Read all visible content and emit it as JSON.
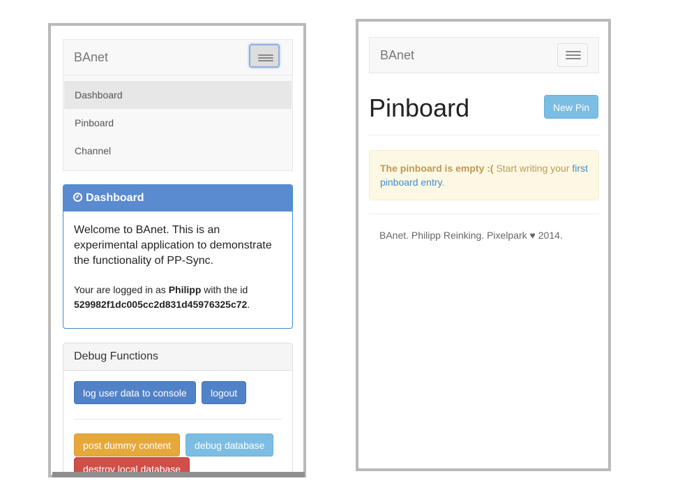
{
  "left": {
    "brand": "BAnet",
    "menu": [
      "Dashboard",
      "Pinboard",
      "Channel"
    ],
    "dashboard_panel": {
      "title": "Dashboard",
      "welcome": "Welcome to BAnet. This is an experimental application to demonstrate the functionality of PP-Sync.",
      "logged_prefix": "Your are logged in as ",
      "user": "Philipp",
      "id_prefix": " with the id ",
      "user_id": "529982f1dc005cc2d831d45976325c72",
      "period": "."
    },
    "debug_panel": {
      "title": "Debug Functions",
      "buttons": [
        "log user data to console",
        "logout",
        "post dummy content",
        "debug database",
        "destroy local database"
      ]
    }
  },
  "right": {
    "brand": "BAnet",
    "page_title": "Pinboard",
    "new_pin_label": "New Pin",
    "alert_bold": "The pinboard is empty :(",
    "alert_text": " Start writing your ",
    "alert_link": "first pinboard entry",
    "alert_end": ".",
    "footer": "BAnet. Philipp Reinking. Pixelpark ♥ 2014."
  },
  "colors": {
    "primary": "#5182c8",
    "warning": "#e7a83b",
    "info": "#7cbde3",
    "danger": "#cf4f49",
    "alert_bg": "#fcf8e3"
  }
}
